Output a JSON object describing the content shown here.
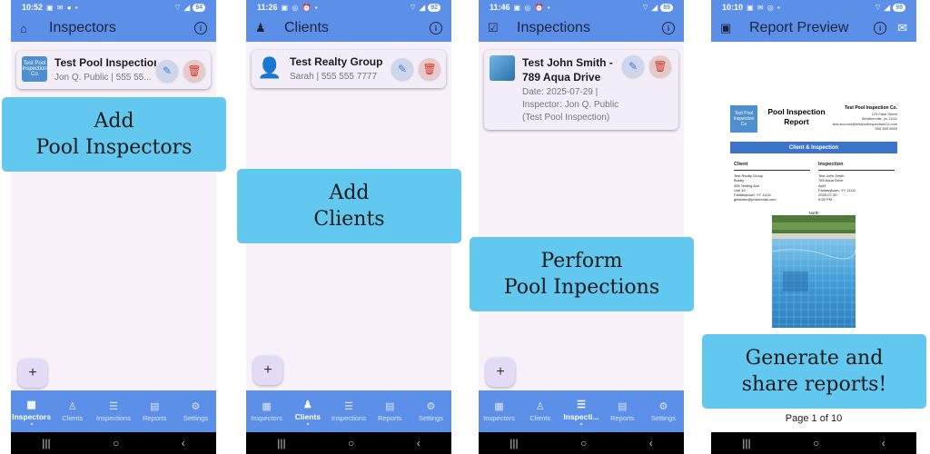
{
  "phones": [
    {
      "status": {
        "time": "10:52",
        "battery": "94"
      },
      "appbar": {
        "title": "Inspectors",
        "lead_icon": "home-icon"
      },
      "card": {
        "name": "Test Pool Inspection",
        "sub": "Jon Q. Public | 555 55...",
        "thumb_text": "Test Pool Inspection Co"
      },
      "nav": [
        "Inspectors",
        "Clients",
        "Inspections",
        "Reports",
        "Settings"
      ],
      "active_nav": "Inspectors",
      "callout": "Add\nPool Inspectors"
    },
    {
      "status": {
        "time": "11:26",
        "battery": "92"
      },
      "appbar": {
        "title": "Clients",
        "lead_icon": "person-icon"
      },
      "card": {
        "name": "Test Realty Group",
        "sub": "Sarah | 555 555 7777"
      },
      "nav": [
        "Inspectors",
        "Clients",
        "Inspections",
        "Reports",
        "Settings"
      ],
      "active_nav": "Clients",
      "callout": "Add\nClients"
    },
    {
      "status": {
        "time": "11:46",
        "battery": "89"
      },
      "appbar": {
        "title": "Inspections",
        "lead_icon": "checklist-icon"
      },
      "card": {
        "name": "Test John Smith -\n789 Aqua Drive",
        "sub": "Date: 2025-07-29 |\nInspector: Jon Q. Public\n(Test Pool Inspection)"
      },
      "nav": [
        "Inspectors",
        "Clients",
        "Inspecti...",
        "Reports",
        "Settings"
      ],
      "active_nav": "Inspecti...",
      "callout": "Perform\nPool Inpections"
    },
    {
      "status": {
        "time": "10:10",
        "battery": "98"
      },
      "appbar": {
        "title": "Report Preview",
        "lead_icon": "document-icon"
      },
      "callout": "Generate and\nshare reports!",
      "page_indicator": "Page 1 of 10",
      "report": {
        "title": "Pool Inspection\nReport",
        "logo_text": "Test Pool Inspection Co",
        "company_name": "Test Pool Inspection Co.",
        "company_lines": [
          "123 Fake Street",
          "Weatherville, ys 11111",
          "test.account@testpoolinspectionCo.com",
          "555 555 5555"
        ],
        "band": "Client & Inspection",
        "client_heading": "Client",
        "client_lines": [
          "Test Realty Group",
          "Busby",
          "456 Testing Ave",
          "Unit 10",
          "Fantasytown, YY 11111",
          "gtestdev@protonmail.com"
        ],
        "inspection_heading": "Inspection",
        "inspection_lines": [
          "Test John Smith",
          "789 Aqua Drive",
          "Apt3",
          "Fantasytown, YY 11111",
          "2025-07-30",
          "9:05 PM"
        ],
        "photo_caption": "North"
      }
    }
  ],
  "colors": {
    "appbar": "#5b8fe8",
    "callout": "#63c8f0",
    "band": "#3d73c9",
    "delete": "#d13b2e",
    "edit": "#3a7be0"
  }
}
